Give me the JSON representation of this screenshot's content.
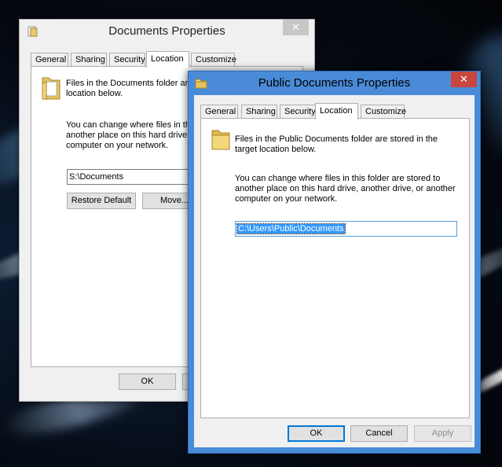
{
  "back_window": {
    "title": "Documents Properties",
    "close_glyph": "✕",
    "tabs": [
      {
        "label": "General",
        "active": false
      },
      {
        "label": "Sharing",
        "active": false
      },
      {
        "label": "Security",
        "active": false
      },
      {
        "label": "Location",
        "active": true
      },
      {
        "label": "Customize",
        "active": false
      }
    ],
    "info_line1": "Files in the Documents folder are",
    "info_line2": "location below.",
    "change_line1": "You can change where files in this",
    "change_line2": "another place on this hard drive, a",
    "change_line3": "computer on your network.",
    "path_value": "S:\\Documents",
    "restore_default_label": "Restore Default",
    "move_label": "Move...",
    "ok_label": "OK"
  },
  "front_window": {
    "title": "Public Documents Properties",
    "close_glyph": "✕",
    "tabs": [
      {
        "label": "General",
        "active": false
      },
      {
        "label": "Sharing",
        "active": false
      },
      {
        "label": "Security",
        "active": false
      },
      {
        "label": "Location",
        "active": true
      },
      {
        "label": "Customize",
        "active": false
      }
    ],
    "info_line1": "Files in the Public Documents folder are stored in the",
    "info_line2": "target location below.",
    "change_line1": "You can change where files in this folder are stored to",
    "change_line2": "another place on this hard drive, another drive, or another",
    "change_line3": "computer on your network.",
    "path_value": "C:\\Users\\Public\\Documents",
    "ok_label": "OK",
    "cancel_label": "Cancel",
    "apply_label": "Apply"
  },
  "icons": {
    "folder": "folder-icon",
    "window": "properties-window-icon",
    "close": "close-icon"
  },
  "colors": {
    "active_frame": "#4a8bd8",
    "inactive_frame": "#f0f0f0",
    "close_active": "#c7463d",
    "close_inactive": "#c7c7c7",
    "selection": "#3399ff"
  }
}
